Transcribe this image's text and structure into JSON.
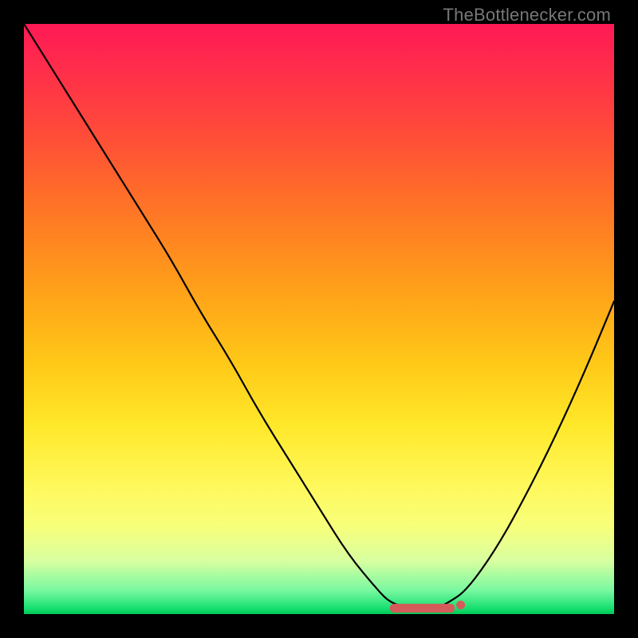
{
  "watermark": "TheBottlenecker.com",
  "colors": {
    "gradient_top": "#ff1a55",
    "gradient_bottom": "#00c858",
    "marker": "#d55a5a",
    "curve": "#000000",
    "frame": "#000000"
  },
  "chart_data": {
    "type": "line",
    "title": "",
    "xlabel": "",
    "ylabel": "",
    "xlim": [
      0,
      100
    ],
    "ylim": [
      0,
      100
    ],
    "x": [
      0,
      5,
      10,
      15,
      20,
      25,
      30,
      35,
      40,
      45,
      50,
      55,
      60,
      62,
      65,
      68,
      70,
      72,
      75,
      80,
      85,
      90,
      95,
      100
    ],
    "values": [
      100,
      92,
      84,
      76,
      68,
      60,
      51,
      43,
      34,
      26,
      18,
      10,
      4,
      2,
      1,
      1,
      1,
      2,
      4,
      11,
      20,
      30,
      41,
      53
    ],
    "marker_range_x": [
      62,
      73
    ],
    "marker_point_x": 74,
    "marker_y": 1,
    "annotations": []
  }
}
